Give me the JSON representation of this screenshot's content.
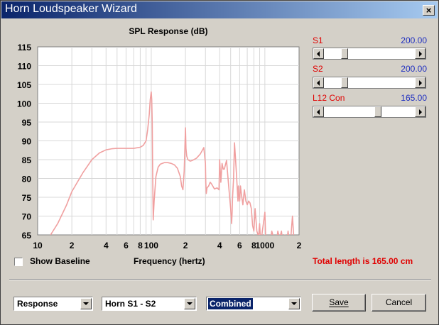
{
  "window": {
    "title": "Horn Loudspeaker Wizard",
    "close_label": "×"
  },
  "sliders": [
    {
      "label": "S1",
      "value": "200.00",
      "position": 0.2
    },
    {
      "label": "S2",
      "value": "200.00",
      "position": 0.2
    },
    {
      "label": "L12 Con",
      "value": "165.00",
      "position": 0.6
    }
  ],
  "options": {
    "show_baseline_label": "Show Baseline",
    "show_baseline_checked": false
  },
  "total_length_text": "Total length is 165.00 cm",
  "combos": [
    {
      "value": "Response",
      "selected": false
    },
    {
      "value": "Horn S1 - S2",
      "selected": false
    },
    {
      "value": "Combined",
      "selected": true
    }
  ],
  "buttons": {
    "save": "Save",
    "cancel": "Cancel"
  },
  "colors": {
    "curve": "#f0a0a0",
    "accent_red": "#e00000",
    "accent_blue": "#2030c0",
    "grid": "#d8d8d8"
  },
  "chart_data": {
    "type": "line",
    "title": "SPL Response (dB)",
    "xlabel": "Frequency (hertz)",
    "ylabel": "",
    "x_scale": "log",
    "xlim": [
      10,
      2000
    ],
    "ylim": [
      65,
      115
    ],
    "grid": true,
    "y_ticks": [
      65,
      70,
      75,
      80,
      85,
      90,
      95,
      100,
      105,
      110,
      115
    ],
    "x_ticks": [
      {
        "value": 10,
        "label": "10"
      },
      {
        "value": 20,
        "label": "2"
      },
      {
        "value": 40,
        "label": "4"
      },
      {
        "value": 60,
        "label": "6"
      },
      {
        "value": 80,
        "label": "8"
      },
      {
        "value": 100,
        "label": "100"
      },
      {
        "value": 200,
        "label": "2"
      },
      {
        "value": 400,
        "label": "4"
      },
      {
        "value": 600,
        "label": "6"
      },
      {
        "value": 800,
        "label": "8"
      },
      {
        "value": 1000,
        "label": "1000"
      },
      {
        "value": 2000,
        "label": "2"
      }
    ],
    "series": [
      {
        "x": [
          13,
          15,
          18,
          20,
          25,
          30,
          35,
          40,
          45,
          50,
          60,
          70,
          80,
          85,
          90,
          93,
          96,
          98,
          100,
          101,
          102,
          103,
          104,
          106,
          110,
          115,
          120,
          130,
          140,
          150,
          160,
          170,
          180,
          185,
          190,
          195,
          200,
          202,
          205,
          210,
          220,
          230,
          250,
          270,
          290,
          300,
          302,
          305,
          308,
          310,
          320,
          330,
          340,
          360,
          380,
          395,
          400,
          405,
          410,
          420,
          430,
          440,
          460,
          480,
          500,
          505,
          510,
          515,
          520,
          530,
          540,
          550,
          560,
          575,
          580,
          585,
          590,
          600,
          610,
          620,
          640,
          650,
          660,
          680,
          700,
          720,
          740,
          760,
          780,
          800,
          820,
          850,
          870,
          880,
          890,
          900,
          920,
          950,
          980,
          1000,
          1020,
          1050,
          1080,
          1100,
          1150,
          1200,
          1250,
          1300,
          1350,
          1400,
          1450,
          1500,
          1550,
          1600,
          1650,
          1700,
          1750,
          1800
        ],
        "y": [
          65,
          68,
          73,
          76.5,
          81.5,
          85,
          86.8,
          87.6,
          87.9,
          88,
          88,
          88,
          88.3,
          88.8,
          90,
          93,
          97,
          101,
          103,
          101,
          95,
          80,
          69,
          74,
          80.5,
          83,
          83.8,
          84.2,
          84.2,
          84,
          83.6,
          82.7,
          80.5,
          78,
          77,
          82,
          93.5,
          88,
          86,
          85,
          84.6,
          84.8,
          85.4,
          86.5,
          88.2,
          84,
          79,
          76,
          77,
          77.5,
          78,
          79,
          78.5,
          77.2,
          77.5,
          77,
          85,
          82,
          79,
          84,
          82.5,
          82.5,
          84.8,
          78,
          72,
          70,
          68,
          71,
          75,
          80,
          89.5,
          86,
          82,
          76,
          74,
          78,
          76,
          74,
          78,
          76,
          73,
          75,
          77,
          74,
          73,
          74,
          73.5,
          72,
          67.5,
          66,
          72,
          66,
          65,
          64,
          66.5,
          68,
          62,
          66,
          69,
          71,
          63,
          64,
          60,
          62,
          66,
          64,
          62,
          66,
          64,
          66,
          62,
          65,
          62,
          66,
          63,
          65,
          70,
          64
        ]
      }
    ]
  }
}
